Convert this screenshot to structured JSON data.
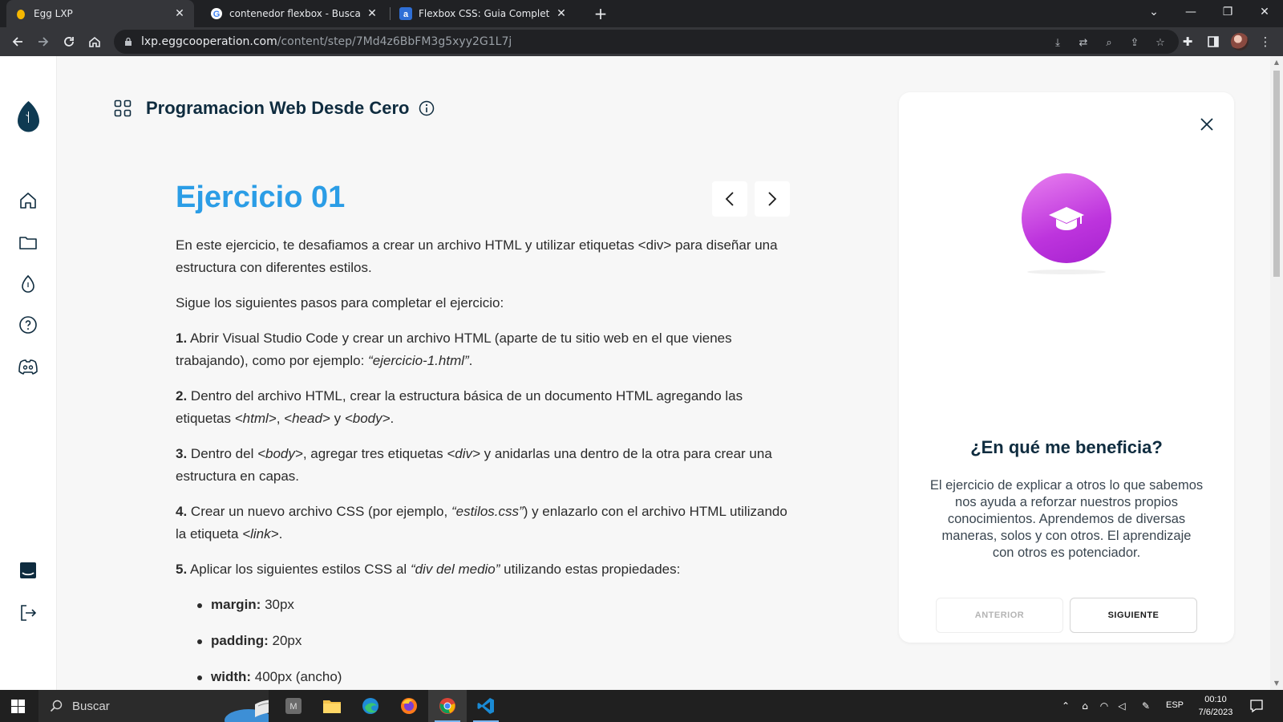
{
  "browser": {
    "tabs": [
      {
        "title": "Egg LXP",
        "active": true
      },
      {
        "title": "contenedor flexbox - Buscar con",
        "active": false
      },
      {
        "title": "Flexbox CSS: Guia Completo, Elem",
        "active": false
      }
    ],
    "new_tab": "+",
    "url_host": "lxp.eggcooperation.com",
    "url_path": "/content/step/7Md4z6BbFM3g5xyy2G1L7j"
  },
  "page": {
    "course_title": "Programacion Web Desde Cero",
    "exercise_title": "Ejercicio 01",
    "intro": "En este ejercicio, te desafiamos a crear un archivo HTML y utilizar etiquetas <div> para diseñar una estructura con diferentes estilos.",
    "steps_intro": "Sigue los siguientes pasos para completar el ejercicio:",
    "steps": [
      {
        "num": "1.",
        "parts": [
          {
            "t": " Abrir Visual Studio Code y crear un archivo HTML (aparte de tu sitio web en el que vienes trabajando), como por ejemplo: "
          },
          {
            "t": "“ejercicio-1.html”",
            "i": true
          },
          {
            "t": "."
          }
        ]
      },
      {
        "num": "2.",
        "parts": [
          {
            "t": " Dentro del archivo HTML, crear la estructura básica de un documento HTML agregando las etiquetas "
          },
          {
            "t": "<html>",
            "i": true
          },
          {
            "t": ", "
          },
          {
            "t": "<head>",
            "i": true
          },
          {
            "t": " y "
          },
          {
            "t": "<body>",
            "i": true
          },
          {
            "t": "."
          }
        ]
      },
      {
        "num": "3.",
        "parts": [
          {
            "t": " Dentro del "
          },
          {
            "t": "<body>",
            "i": true
          },
          {
            "t": ", agregar tres etiquetas "
          },
          {
            "t": "<div>",
            "i": true
          },
          {
            "t": " y anidarlas una dentro de la otra para crear una estructura en capas."
          }
        ]
      },
      {
        "num": "4.",
        "parts": [
          {
            "t": " Crear un nuevo archivo CSS (por ejemplo, "
          },
          {
            "t": "“estilos.css”",
            "i": true
          },
          {
            "t": ") y enlazarlo con el archivo HTML utilizando la etiqueta "
          },
          {
            "t": "<link>",
            "i": true
          },
          {
            "t": "."
          }
        ]
      },
      {
        "num": "5.",
        "parts": [
          {
            "t": " Aplicar los siguientes estilos CSS al "
          },
          {
            "t": "“div del medio”",
            "i": true
          },
          {
            "t": " utilizando estas propiedades:"
          }
        ]
      }
    ],
    "css_props": [
      {
        "name": "margin:",
        "value": " 30px"
      },
      {
        "name": "padding:",
        "value": " 20px"
      },
      {
        "name": "width:",
        "value": " 400px (ancho)"
      }
    ]
  },
  "card": {
    "title": "¿En qué me beneficia?",
    "text": "El ejercicio de explicar a otros lo que sabemos nos ayuda a reforzar nuestros propios conocimientos. Aprendemos de diversas maneras, solos y con otros. El aprendizaje con otros es potenciador.",
    "prev_label": "ANTERIOR",
    "next_label": "SIGUIENTE"
  },
  "taskbar": {
    "search_label": "Buscar",
    "lang": "ESP",
    "time": "00:10",
    "date": "7/6/2023"
  },
  "colors": {
    "accent_blue": "#2b9de6",
    "navy": "#0f2c3f",
    "badge_purple": "#bd34dd"
  }
}
